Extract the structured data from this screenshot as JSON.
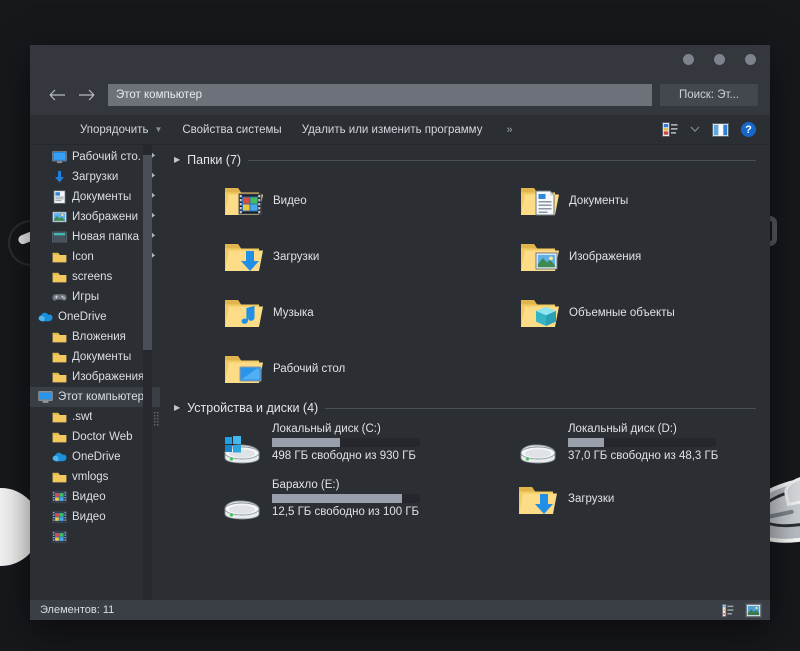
{
  "window": {
    "title_buttons": [
      "minimize",
      "maximize",
      "close"
    ],
    "address_value": "Этот компьютер",
    "address_placeholder": "Этот компьютер",
    "search_value": "Поиск: Эт...",
    "search_placeholder": "Поиск: Этот компьютер",
    "back_icon": "arrow-left-icon",
    "forward_icon": "arrow-right-icon"
  },
  "toolbar": {
    "items": [
      {
        "label": "Упорядочить",
        "has_caret": true
      },
      {
        "label": "Свойства системы",
        "has_caret": false
      },
      {
        "label": "Удалить или изменить программу",
        "has_caret": false
      }
    ],
    "overflow_label": "»",
    "right_icons": [
      "view-options-icon",
      "chevron-down-icon",
      "preview-pane-icon",
      "help-icon"
    ],
    "help_label": "?"
  },
  "sidebar": {
    "items": [
      {
        "label": "Рабочий сто.",
        "icon": "desktop-icon",
        "indent": 1,
        "pinned": true,
        "selected": false
      },
      {
        "label": "Загрузки",
        "icon": "downloads-icon",
        "indent": 1,
        "pinned": true,
        "selected": false
      },
      {
        "label": "Документы",
        "icon": "documents-icon",
        "indent": 1,
        "pinned": true,
        "selected": false
      },
      {
        "label": "Изображени",
        "icon": "pictures-icon",
        "indent": 1,
        "pinned": true,
        "selected": false
      },
      {
        "label": "Новая папка",
        "icon": "newfolder-icon",
        "indent": 1,
        "pinned": true,
        "selected": false
      },
      {
        "label": "Icon",
        "icon": "folder-icon",
        "indent": 1,
        "pinned": true,
        "selected": false
      },
      {
        "label": "screens",
        "icon": "folder-icon",
        "indent": 1,
        "pinned": false,
        "selected": false
      },
      {
        "label": "Игры",
        "icon": "gamepad-icon",
        "indent": 1,
        "pinned": false,
        "selected": false
      },
      {
        "label": "OneDrive",
        "icon": "onedrive-icon",
        "indent": 0,
        "pinned": false,
        "selected": false
      },
      {
        "label": "Вложения",
        "icon": "folder-icon",
        "indent": 1,
        "pinned": false,
        "selected": false
      },
      {
        "label": "Документы",
        "icon": "folder-icon",
        "indent": 1,
        "pinned": false,
        "selected": false
      },
      {
        "label": "Изображения",
        "icon": "folder-icon",
        "indent": 1,
        "pinned": false,
        "selected": false
      },
      {
        "label": "Этот компьютер",
        "icon": "computer-icon",
        "indent": 0,
        "pinned": false,
        "selected": true
      },
      {
        "label": ".swt",
        "icon": "folder-icon",
        "indent": 1,
        "pinned": false,
        "selected": false
      },
      {
        "label": "Doctor Web",
        "icon": "folder-icon",
        "indent": 1,
        "pinned": false,
        "selected": false
      },
      {
        "label": "OneDrive",
        "icon": "onedrive-icon",
        "indent": 1,
        "pinned": false,
        "selected": false
      },
      {
        "label": "vmlogs",
        "icon": "folder-icon",
        "indent": 1,
        "pinned": false,
        "selected": false
      },
      {
        "label": "Видео",
        "icon": "video-folder-icon",
        "indent": 1,
        "pinned": false,
        "selected": false
      },
      {
        "label": "Видео",
        "icon": "video-folder-icon",
        "indent": 1,
        "pinned": false,
        "selected": false
      },
      {
        "label": "",
        "icon": "video-folder-icon",
        "indent": 1,
        "pinned": false,
        "selected": false
      }
    ]
  },
  "content": {
    "folders_group": {
      "title": "Папки (7)",
      "items": [
        {
          "name": "Видео",
          "icon": "videos-folder-icon"
        },
        {
          "name": "Документы",
          "icon": "documents-folder-icon"
        },
        {
          "name": "Загрузки",
          "icon": "downloads-folder-icon"
        },
        {
          "name": "Изображения",
          "icon": "pictures-folder-icon"
        },
        {
          "name": "Музыка",
          "icon": "music-folder-icon"
        },
        {
          "name": "Объемные объекты",
          "icon": "objects3d-folder-icon"
        },
        {
          "name": "Рабочий стол",
          "icon": "desktop-folder-icon"
        }
      ]
    },
    "drives_group": {
      "title": "Устройства и диски (4)",
      "items": [
        {
          "name": "Локальный диск (C:)",
          "icon": "system-drive-icon",
          "free_text": "498 ГБ свободно из 930 ГБ",
          "used_percent": 46,
          "has_bar": true
        },
        {
          "name": "Локальный диск (D:)",
          "icon": "drive-icon",
          "free_text": "37,0 ГБ свободно из 48,3 ГБ",
          "used_percent": 24,
          "has_bar": true
        },
        {
          "name": "Барахло (E:)",
          "icon": "drive-icon",
          "free_text": "12,5 ГБ свободно из 100 ГБ",
          "used_percent": 88,
          "has_bar": true
        },
        {
          "name": "Загрузки",
          "icon": "downloads-folder-icon",
          "free_text": "",
          "used_percent": 0,
          "has_bar": false
        }
      ]
    }
  },
  "statusbar": {
    "text": "Элементов: 11",
    "views": [
      "details-view-icon",
      "tiles-view-icon"
    ]
  },
  "colors": {
    "window_bg": "#2b2e33",
    "chrome_bg": "#34373d",
    "accent_blue": "#1668c8",
    "folder_yellow": "#f4cd6a",
    "drive_bar_fill": "#9aa0ab",
    "selection": "#3a3e45"
  }
}
